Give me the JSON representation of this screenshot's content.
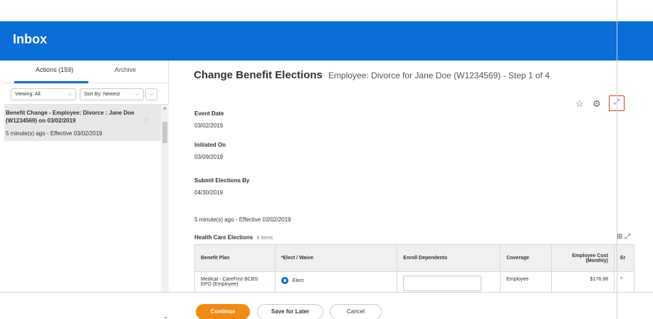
{
  "header": {
    "title": "Inbox"
  },
  "left": {
    "tabs": [
      {
        "label": "Actions (159)"
      },
      {
        "label": "Archive"
      }
    ],
    "filters": {
      "viewing": "Viewing: All",
      "sort": "Sort By: Newest"
    },
    "item": {
      "title": "Benefit Change - Employee: Divorce : Jane Doe (W1234569) on 03/02/2019",
      "meta": "5 minute(s) ago - Effective 03/02/2019"
    }
  },
  "main": {
    "title": "Change Benefit Elections",
    "subtitle": "Employee: Divorce for Jane Doe (W1234569) - Step 1 of 4",
    "fields": [
      {
        "label": "Event Date",
        "value": "03/02/2019"
      },
      {
        "label": "Initiated On",
        "value": "03/09/2019"
      },
      {
        "label": "Submit Elections By",
        "value": "04/30/2019"
      }
    ],
    "effective_note": "5 minute(s) ago - Effective 03/02/2019",
    "health_care": {
      "title": "Health Care Elections",
      "count": "8 items",
      "columns": [
        "Benefit Plan",
        "*Elect / Waive",
        "Enroll Dependents",
        "Coverage",
        "Employee Cost (Monthly)",
        "Er"
      ],
      "rows": [
        {
          "plan": "Medical - CareFirst BCBS EPO (Employee)",
          "elect": "Elect",
          "coverage": "Employee",
          "cost": "$176.98"
        }
      ]
    }
  },
  "footer": {
    "continue": "Continue",
    "save_later": "Save for Later",
    "cancel": "Cancel"
  }
}
